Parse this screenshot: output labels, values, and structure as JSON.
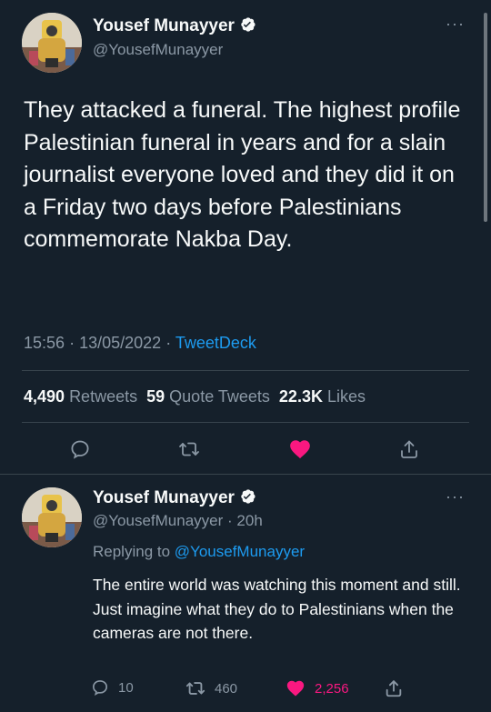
{
  "main_tweet": {
    "author_name": "Yousef Munayyer",
    "handle": "@YousefMunayyer",
    "text": "They attacked a funeral. The highest profile Palestinian funeral in years and for a slain journalist everyone loved and they did it on a Friday two days before Palestinians commemorate Nakba Day.",
    "time": "15:56",
    "date": "13/05/2022",
    "separator": "·",
    "source": "TweetDeck",
    "stats": {
      "retweets_count": "4,490",
      "retweets_label": "Retweets",
      "quotes_count": "59",
      "quotes_label": "Quote Tweets",
      "likes_count": "22.3K",
      "likes_label": "Likes"
    }
  },
  "reply_tweet": {
    "author_name": "Yousef Munayyer",
    "handle": "@YousefMunayyer",
    "age": "20h",
    "separator": "·",
    "replying_prefix": "Replying to",
    "replying_handle": "@YousefMunayyer",
    "text": "The entire world was watching this moment and still. Just imagine what they do to Palestinians when the cameras are not there.",
    "replies_count": "10",
    "retweets_count": "460",
    "likes_count": "2,256"
  },
  "colors": {
    "background": "#15202b",
    "accent": "#1d9bf0",
    "like": "#f91880",
    "muted": "#8b98a5"
  },
  "icons": [
    "verified-badge-icon",
    "more-icon",
    "reply-icon",
    "retweet-icon",
    "like-icon",
    "share-icon"
  ]
}
